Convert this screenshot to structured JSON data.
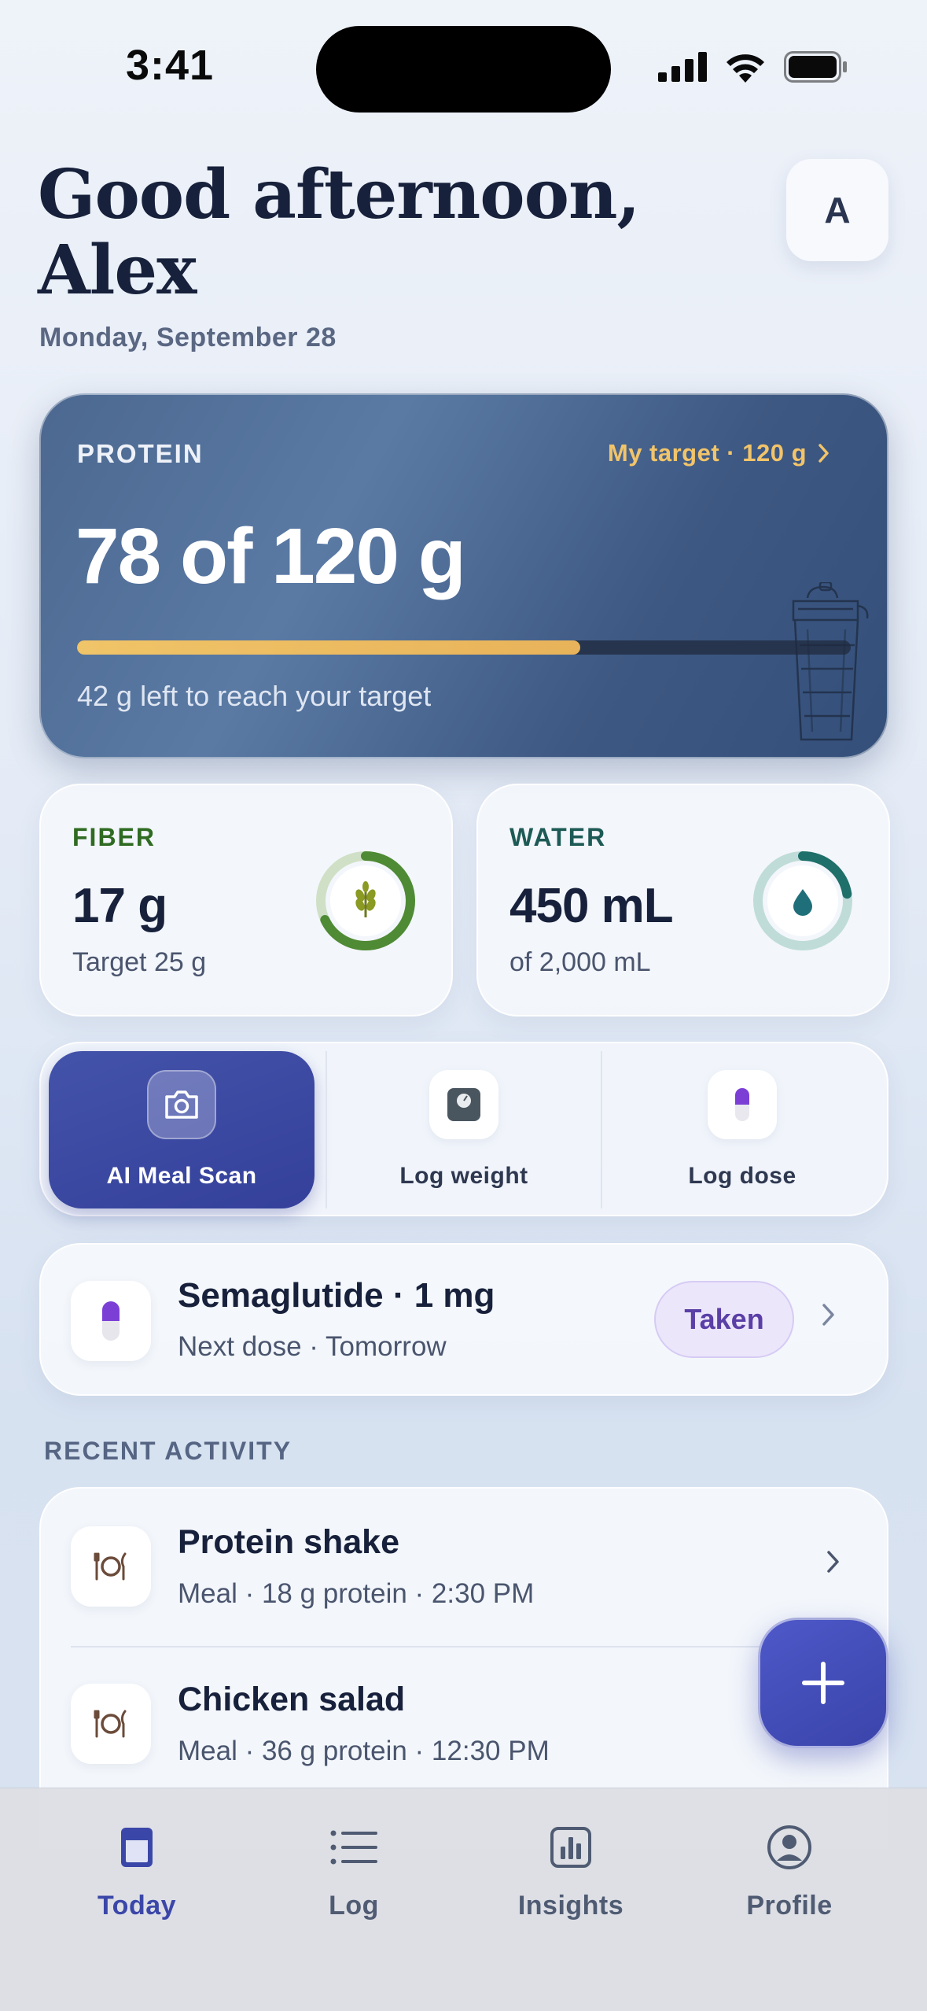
{
  "status_bar": {
    "time": "3:41"
  },
  "header": {
    "greeting_line1": "Good afternoon,",
    "greeting_line2": "Alex",
    "date": "Monday, September 28",
    "avatar_initial": "A"
  },
  "protein": {
    "label": "PROTEIN",
    "target_link": "My target · 120 g",
    "value": "78 of 120 g",
    "progress": 0.65,
    "note": "42 g left to reach your target"
  },
  "fiber": {
    "label": "FIBER",
    "value": "17 g",
    "sub": "Target 25 g",
    "progress": 0.68,
    "color": "#4f8a35"
  },
  "water": {
    "label": "WATER",
    "value": "450 mL",
    "sub": "of 2,000 mL",
    "progress": 0.225,
    "color": "#1f6f6a"
  },
  "actions": {
    "scan_label": "AI Meal Scan",
    "weight_label": "Log weight",
    "dose_label": "Log dose"
  },
  "medication": {
    "name": "Semaglutide · 1 mg",
    "next": "Next dose · Tomorrow",
    "status": "Taken"
  },
  "recent_activity": {
    "title": "RECENT ACTIVITY",
    "items": [
      {
        "title": "Protein shake",
        "sub": "Meal · 18 g protein · 2:30 PM"
      },
      {
        "title": "Chicken salad",
        "sub": "Meal · 36 g protein · 12:30 PM"
      }
    ]
  },
  "tabs": [
    {
      "label": "Today",
      "icon": "today-icon",
      "active": true
    },
    {
      "label": "Log",
      "icon": "list-icon",
      "active": false
    },
    {
      "label": "Insights",
      "icon": "chart-icon",
      "active": false
    },
    {
      "label": "Profile",
      "icon": "profile-icon",
      "active": false
    }
  ],
  "colors": {
    "accent": "#3b47a8",
    "protein_bar": "#f0c468",
    "badge": "#5a3fa6"
  }
}
